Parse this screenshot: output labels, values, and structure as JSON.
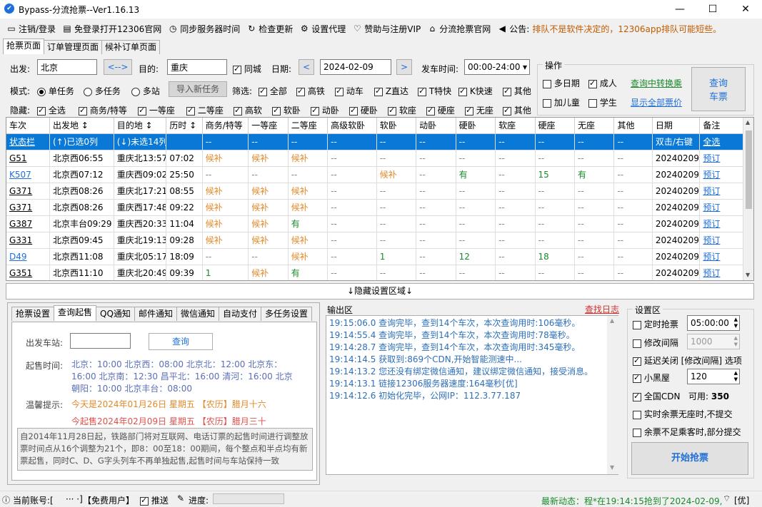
{
  "window": {
    "title": "Bypass-分流抢票--Ver1.16.13",
    "min": "—",
    "max": "☐",
    "close": "✕"
  },
  "menu": [
    {
      "icon": "monitor-icon",
      "glyph": "▭",
      "label": "注销/登录"
    },
    {
      "icon": "browser-icon",
      "glyph": "▤",
      "label": "免登录打开12306官网"
    },
    {
      "icon": "clock-icon",
      "glyph": "◷",
      "label": "同步服务器时间"
    },
    {
      "icon": "refresh-icon",
      "glyph": "↻",
      "label": "检查更新"
    },
    {
      "icon": "gear-icon",
      "glyph": "⚙",
      "label": "设置代理"
    },
    {
      "icon": "heart-icon",
      "glyph": "♡",
      "label": "赞助与注册VIP"
    },
    {
      "icon": "home-icon",
      "glyph": "⌂",
      "label": "分流抢票官网"
    },
    {
      "icon": "speaker-icon",
      "glyph": "◀",
      "label": "公告:"
    }
  ],
  "notice": "排队不是软件决定的，12306app排队可能短些。",
  "page_tabs": [
    "抢票页面",
    "订单管理页面",
    "候补订单页面"
  ],
  "form": {
    "from_label": "出发:",
    "from_value": "北京",
    "swap": "<-->",
    "to_label": "目的:",
    "to_value": "重庆",
    "same_city": "同城",
    "date_label": "日期:",
    "date_value": "2024-02-09",
    "prev": "<",
    "next": ">",
    "depart_label": "发车时间:",
    "depart_value": "00:00-24:00",
    "depart_arrow": "▾",
    "mode_label": "模式:",
    "modes": [
      "单任务",
      "多任务",
      "多站"
    ],
    "import_btn": "导入新任务",
    "filter_label": "筛选:",
    "filters": [
      "全部",
      "高铁",
      "动车",
      "Z直达",
      "T特快",
      "K快速",
      "其他"
    ],
    "hide_label": "隐藏:",
    "hides": [
      "全选",
      "商务/特等",
      "一等座",
      "二等座",
      "高软",
      "软卧",
      "动卧",
      "硬卧",
      "软座",
      "硬座",
      "无座",
      "其他"
    ],
    "ops_label": "操作",
    "ops_multi_date": "多日期",
    "ops_adult": "成人",
    "ops_transfer": "查询中转换乘",
    "ops_child": "加儿童",
    "ops_student": "学生",
    "ops_show_price": "显示全部票价",
    "query_btn_1": "查询",
    "query_btn_2": "车票"
  },
  "table": {
    "headers": [
      "车次",
      "出发地 ↕",
      "目的地 ↕",
      "历时 ↕",
      "商务/特等",
      "一等座",
      "二等座",
      "高级软卧",
      "软卧",
      "动卧",
      "硬卧",
      "软座",
      "硬座",
      "无座",
      "其他",
      "日期",
      "备注"
    ],
    "status_row": [
      "状态栏",
      "(↑)已选0列",
      "(↓)未选14列",
      "",
      "--",
      "--",
      "--",
      "--",
      "--",
      "--",
      "--",
      "--",
      "--",
      "--",
      "--",
      "双击/右键",
      "全选"
    ],
    "rows": [
      [
        "G51",
        "北京西06:55",
        "重庆北13:57",
        "07:02",
        "候补",
        "候补",
        "候补",
        "--",
        "--",
        "--",
        "--",
        "--",
        "--",
        "--",
        "--",
        "20240209",
        "预订"
      ],
      [
        "K507",
        "北京西07:12",
        "重庆西09:02",
        "25:50",
        "--",
        "--",
        "--",
        "--",
        "候补",
        "--",
        "有",
        "--",
        "15",
        "有",
        "--",
        "20240209",
        "预订"
      ],
      [
        "G371",
        "北京西08:26",
        "重庆北17:21",
        "08:55",
        "候补",
        "候补",
        "候补",
        "--",
        "--",
        "--",
        "--",
        "--",
        "--",
        "--",
        "--",
        "20240209",
        "预订"
      ],
      [
        "G371",
        "北京西08:26",
        "重庆西17:48",
        "09:22",
        "候补",
        "候补",
        "候补",
        "--",
        "--",
        "--",
        "--",
        "--",
        "--",
        "--",
        "--",
        "20240209",
        "预订"
      ],
      [
        "G387",
        "北京丰台09:29",
        "重庆西20:33",
        "11:04",
        "候补",
        "候补",
        "有",
        "--",
        "--",
        "--",
        "--",
        "--",
        "--",
        "--",
        "--",
        "20240209",
        "预订"
      ],
      [
        "G331",
        "北京西09:45",
        "重庆北19:13",
        "09:28",
        "候补",
        "候补",
        "候补",
        "--",
        "--",
        "--",
        "--",
        "--",
        "--",
        "--",
        "--",
        "20240209",
        "预订"
      ],
      [
        "D49",
        "北京西11:08",
        "重庆北05:17",
        "18:09",
        "--",
        "--",
        "候补",
        "--",
        "1",
        "--",
        "12",
        "--",
        "18",
        "--",
        "--",
        "20240209",
        "预订"
      ],
      [
        "G351",
        "北京西11:10",
        "重庆北20:49",
        "09:39",
        "1",
        "候补",
        "有",
        "--",
        "--",
        "--",
        "--",
        "--",
        "--",
        "--",
        "--",
        "20240209",
        "预订"
      ]
    ]
  },
  "hidden_settings_bar": "↓隐藏设置区域↓",
  "left_tabs": [
    "抢票设置",
    "查询起售",
    "QQ通知",
    "邮件通知",
    "微信通知",
    "自动支付",
    "多任务设置"
  ],
  "sale": {
    "station_label": "出发车站:",
    "station_value": "",
    "query_btn": "查询",
    "time_label": "起售时间:",
    "time_lines": [
      "北京：10:00    北京西：08:00    北京北：12:00    北京东：",
      "16:00    北京南：12:30    昌平北：16:00    清河：16:00    北京",
      "朝阳：10:00    北京丰台：08:00"
    ],
    "tip_label": "温馨提示:",
    "tip_today": "今天是2024年01月26日 星期五    【农历】腊月十六",
    "tip_sale": "今起售2024年02月09日 星期五    【农历】腊月三十",
    "note": "自2014年11月28日起，铁路部门将对互联网、电话订票的起售时间进行调整放票时间点从16个调整为21个，即8：00至18：00期间，每个整点和半点均有新票起售，同时C、D、G字头列车不再单独起售,起售时间与车站保持一致"
  },
  "output": {
    "label": "输出区",
    "find_log": "查找日志",
    "lines": [
      "19:15:06.0  查询完毕，查到14个车次，本次查询用时:106毫秒。",
      "19:14:55.4  查询完毕，查到14个车次，本次查询用时:78毫秒。",
      "19:14:28.7  查询完毕，查到14个车次，本次查询用时:345毫秒。",
      "19:14:14.5  获取到:869个CDN,开始智能测速中...",
      "19:14:13.2  您还没有绑定微信通知，建议绑定微信通知，接受消息。",
      "19:14:13.1  链接12306服务器速度:164毫秒[优]",
      "19:14:12.6  初始化完毕，公网IP：112.3.77.187"
    ]
  },
  "settings": {
    "label": "设置区",
    "timer_label": "定时抢票",
    "timer_value": "05:00:00",
    "interval_label": "修改间隔",
    "interval_value": "1000",
    "delay_label": "延迟关闭 [修改间隔] 选项",
    "blackroom_label": "小黑屋",
    "blackroom_value": "120",
    "cdn_label": "全国CDN",
    "cdn_avail_label": "可用:",
    "cdn_avail": "350",
    "no_seat_label": "实时余票无座时,不提交",
    "partial_label": "余票不足乘客时,部分提交",
    "start_btn": "开始抢票"
  },
  "statusbar": {
    "account_label": "当前账号:[",
    "account_masked": "··· ·]",
    "user_type": "【免费用户】",
    "push_label": "推送",
    "progress_label": "进度:",
    "news": "最新动态：程*在19:14:15抢到了2024-02-09,",
    "news_tail": "[优]"
  }
}
